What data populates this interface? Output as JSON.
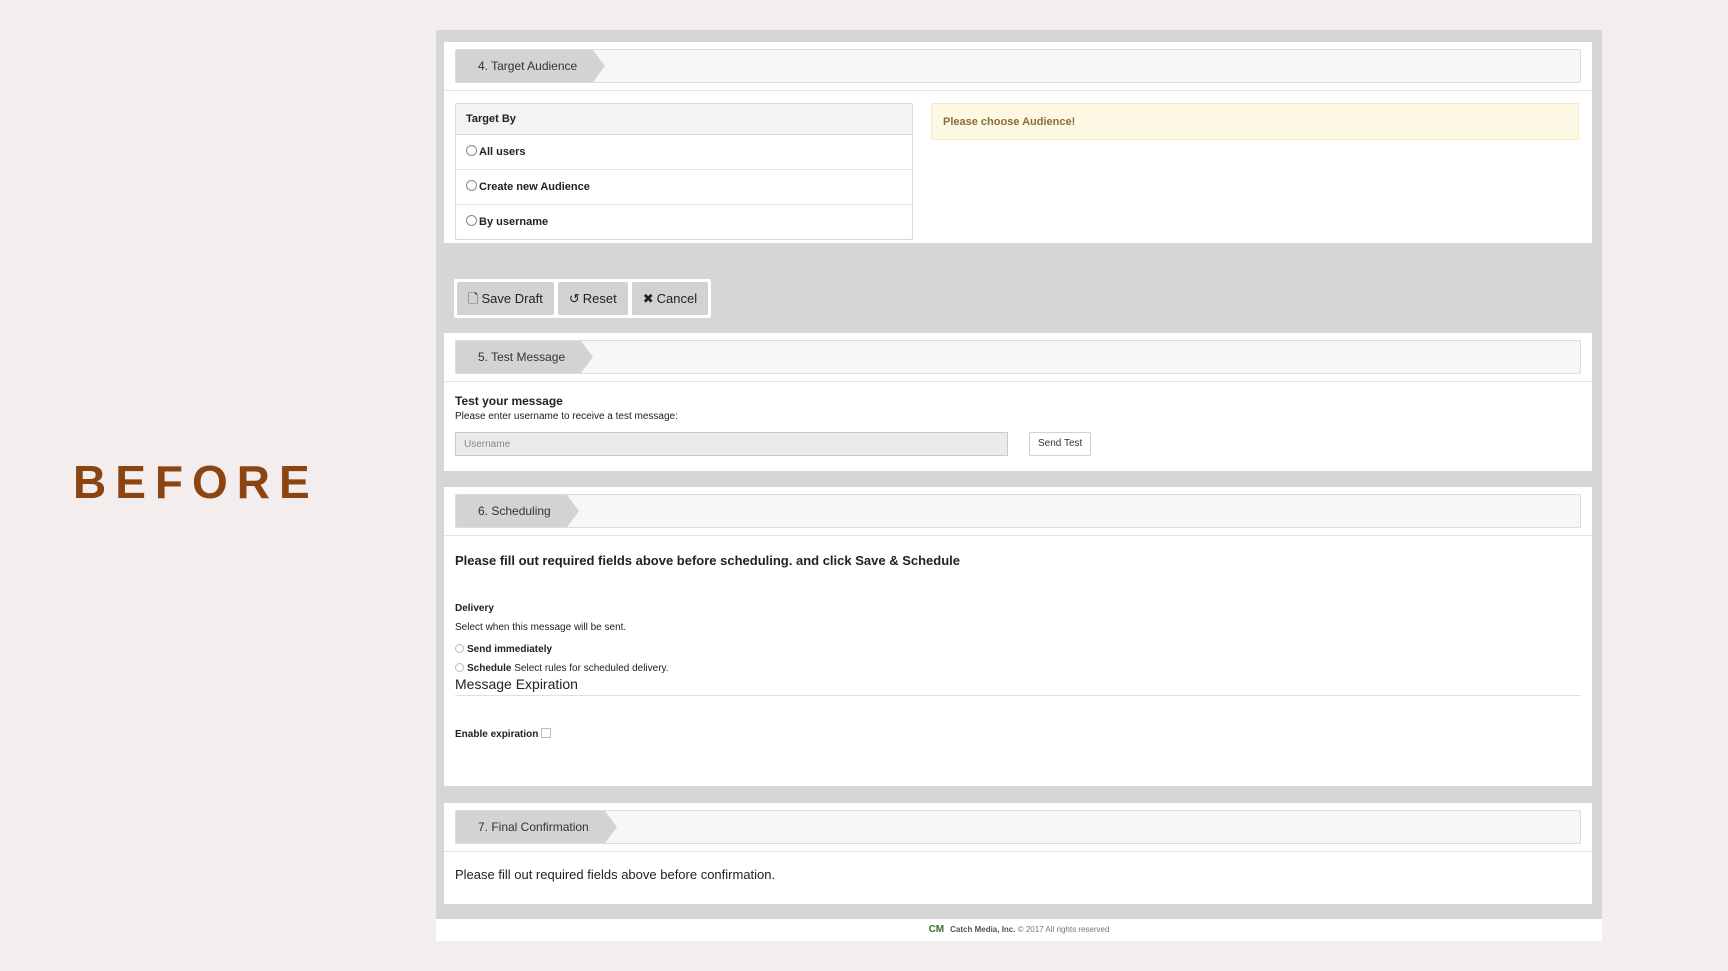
{
  "banner": {
    "label": "BEFORE"
  },
  "target_audience": {
    "step_label": "4. Target Audience",
    "box_header": "Target By",
    "options": [
      "All users",
      "Create new Audience",
      "By username"
    ],
    "alert": "Please choose Audience!"
  },
  "actions": {
    "save_draft": "Save Draft",
    "reset": "Reset",
    "cancel": "Cancel"
  },
  "test_message": {
    "step_label": "5. Test Message",
    "title": "Test your message",
    "subtitle": "Please enter username to receive a test message:",
    "username_placeholder": "Username",
    "send_button": "Send Test"
  },
  "scheduling": {
    "step_label": "6. Scheduling",
    "heading": "Please fill out required fields above before scheduling. and click Save & Schedule",
    "delivery_label": "Delivery",
    "delivery_desc": "Select when this message will be sent.",
    "send_immediately": "Send immediately",
    "schedule_label": "Schedule",
    "schedule_desc": "Select rules for scheduled delivery.",
    "expiration_title": "Message Expiration",
    "enable_expiration": "Enable expiration"
  },
  "final_confirmation": {
    "step_label": "7. Final Confirmation",
    "text": "Please fill out required fields above before confirmation."
  },
  "footer": {
    "logo": "CM",
    "company": "Catch Media, Inc.",
    "copyright": "© 2017 All rights reserved"
  }
}
